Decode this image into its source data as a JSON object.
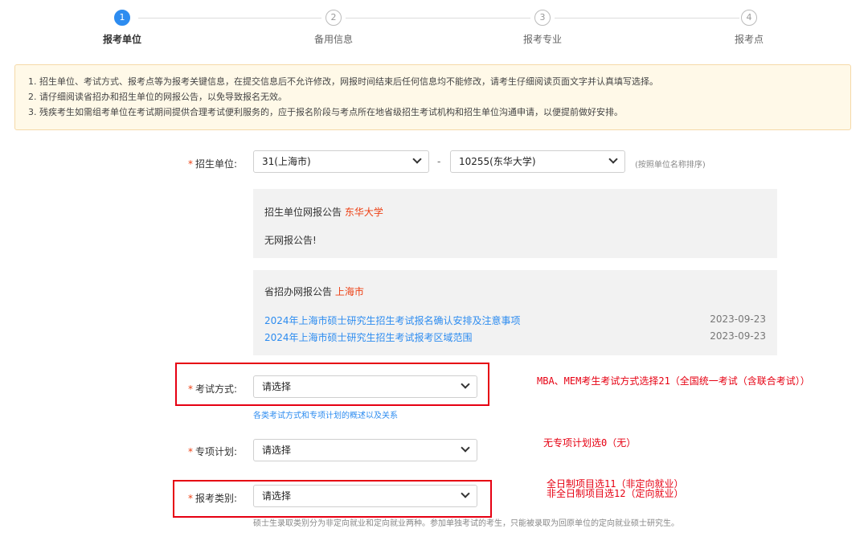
{
  "steps": [
    {
      "num": "1",
      "label": "报考单位"
    },
    {
      "num": "2",
      "label": "备用信息"
    },
    {
      "num": "3",
      "label": "报考专业"
    },
    {
      "num": "4",
      "label": "报考点"
    }
  ],
  "notice": [
    "1. 招生单位、考试方式、报考点等为报考关键信息，在提交信息后不允许修改，网报时间结束后任何信息均不能修改，请考生仔细阅读页面文字并认真填写选择。",
    "2. 请仔细阅读省招办和招生单位的网报公告，以免导致报名无效。",
    "3. 残疾考生如需组考单位在考试期间提供合理考试便利服务的，应于报名阶段与考点所在地省级招生考试机构和招生单位沟通申请，以便提前做好安排。"
  ],
  "form": {
    "required_mark": "*",
    "unit": {
      "label": "招生单位:",
      "province_value": "31(上海市)",
      "separator": "-",
      "school_value": "10255(东华大学)",
      "hint": "(按照单位名称排序)"
    },
    "unit_announcement": {
      "title": "招生单位网报公告",
      "title_highlight": "东华大学",
      "content": "无网报公告!"
    },
    "province_announcement": {
      "title": "省招办网报公告",
      "title_highlight": "上海市",
      "items": [
        {
          "text": "2024年上海市硕士研究生招生考试报名确认安排及注意事项",
          "date": "2023-09-23"
        },
        {
          "text": "2024年上海市硕士研究生招生考试报考区域范围",
          "date": "2023-09-23"
        }
      ]
    },
    "exam_mode": {
      "label": "考试方式:",
      "value": "请选择",
      "help_link": "各类考试方式和专项计划的概述以及关系"
    },
    "special_plan": {
      "label": "专项计划:",
      "value": "请选择"
    },
    "category": {
      "label": "报考类别:",
      "value": "请选择",
      "hint": "硕士生录取类别分为非定向就业和定向就业两种。参加单独考试的考生，只能被录取为回原单位的定向就业硕士研究生。"
    }
  },
  "annotations": {
    "exam_mode": "MBA、MEM考生考试方式选择21（全国统一考试（含联合考试））",
    "special_plan": "无专项计划选0（无）",
    "category_line1": "全日制项目选11（非定向就业）",
    "category_line2": "非全日制项目选12（定向就业）"
  },
  "colors": {
    "accent": "#2d8cf0",
    "required": "#ed4014",
    "annotation": "#e60012",
    "notice_bg": "#fff9e8"
  }
}
